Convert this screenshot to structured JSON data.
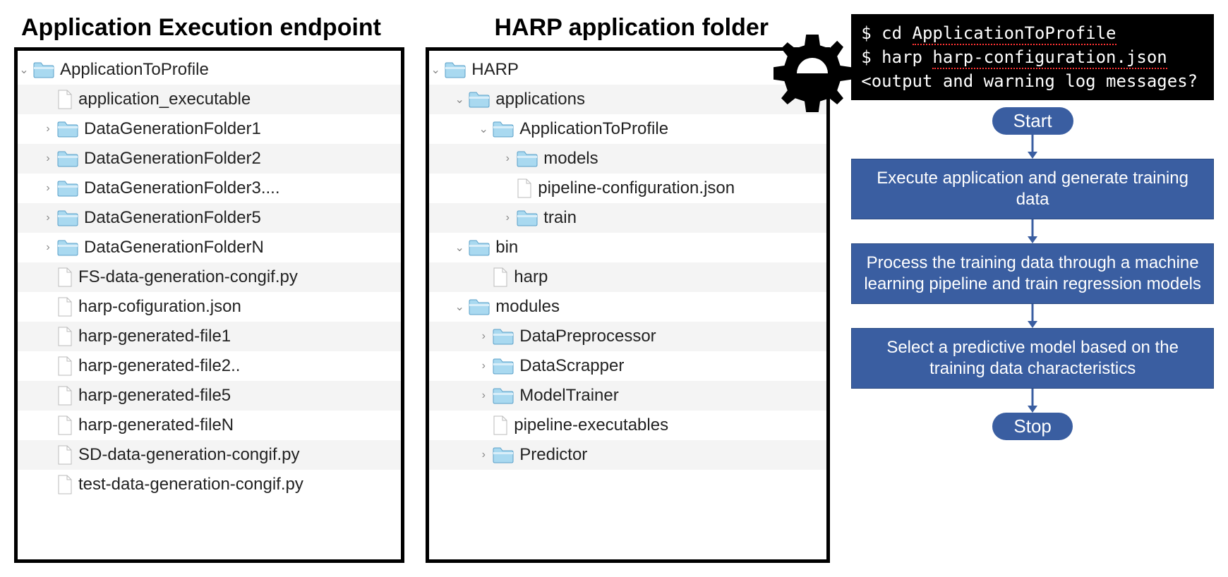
{
  "panelLeft": {
    "title": "Application Execution endpoint",
    "items": [
      {
        "indent": 0,
        "chev": "down",
        "icon": "folder",
        "label": "ApplicationToProfile"
      },
      {
        "indent": 1,
        "chev": "",
        "icon": "file",
        "label": "application_executable"
      },
      {
        "indent": 1,
        "chev": "right",
        "icon": "folder",
        "label": "DataGenerationFolder1"
      },
      {
        "indent": 1,
        "chev": "right",
        "icon": "folder",
        "label": "DataGenerationFolder2"
      },
      {
        "indent": 1,
        "chev": "right",
        "icon": "folder",
        "label": "DataGenerationFolder3...."
      },
      {
        "indent": 1,
        "chev": "right",
        "icon": "folder",
        "label": "DataGenerationFolder5"
      },
      {
        "indent": 1,
        "chev": "right",
        "icon": "folder",
        "label": "DataGenerationFolderN"
      },
      {
        "indent": 1,
        "chev": "",
        "icon": "file",
        "label": "FS-data-generation-congif.py"
      },
      {
        "indent": 1,
        "chev": "",
        "icon": "file",
        "label": "harp-cofiguration.json"
      },
      {
        "indent": 1,
        "chev": "",
        "icon": "file",
        "label": "harp-generated-file1"
      },
      {
        "indent": 1,
        "chev": "",
        "icon": "file",
        "label": "harp-generated-file2.."
      },
      {
        "indent": 1,
        "chev": "",
        "icon": "file",
        "label": "harp-generated-file5"
      },
      {
        "indent": 1,
        "chev": "",
        "icon": "file",
        "label": "harp-generated-fileN"
      },
      {
        "indent": 1,
        "chev": "",
        "icon": "file",
        "label": "SD-data-generation-congif.py"
      },
      {
        "indent": 1,
        "chev": "",
        "icon": "file",
        "label": "test-data-generation-congif.py"
      }
    ]
  },
  "panelMid": {
    "title": "HARP application folder",
    "items": [
      {
        "indent": 0,
        "chev": "down",
        "icon": "folder",
        "label": "HARP"
      },
      {
        "indent": 1,
        "chev": "down",
        "icon": "folder",
        "label": "applications"
      },
      {
        "indent": 2,
        "chev": "down",
        "icon": "folder",
        "label": "ApplicationToProfile"
      },
      {
        "indent": 3,
        "chev": "right",
        "icon": "folder",
        "label": "models"
      },
      {
        "indent": 3,
        "chev": "",
        "icon": "file",
        "label": "pipeline-configuration.json"
      },
      {
        "indent": 3,
        "chev": "right",
        "icon": "folder",
        "label": "train"
      },
      {
        "indent": 1,
        "chev": "down",
        "icon": "folder",
        "label": "bin"
      },
      {
        "indent": 2,
        "chev": "",
        "icon": "file",
        "label": "harp"
      },
      {
        "indent": 1,
        "chev": "down",
        "icon": "folder",
        "label": "modules"
      },
      {
        "indent": 2,
        "chev": "right",
        "icon": "folder",
        "label": "DataPreprocessor"
      },
      {
        "indent": 2,
        "chev": "right",
        "icon": "folder",
        "label": "DataScrapper"
      },
      {
        "indent": 2,
        "chev": "right",
        "icon": "folder",
        "label": "ModelTrainer"
      },
      {
        "indent": 2,
        "chev": "",
        "icon": "file",
        "label": "pipeline-executables"
      },
      {
        "indent": 2,
        "chev": "right",
        "icon": "folder",
        "label": "Predictor"
      }
    ]
  },
  "terminal": {
    "line1_prefix": "$ cd ",
    "line1_underlined": "ApplicationToProfile",
    "line2_prefix": "$ harp ",
    "line2_underlined": "harp-configuration.json",
    "line3": "<output and warning log messages?"
  },
  "flow": {
    "start": "Start",
    "step1": "Execute application and  generate training data",
    "step2": "Process the training data through a machine learning pipeline and train regression models",
    "step3": "Select a predictive model based on the training data characteristics",
    "stop": "Stop"
  }
}
